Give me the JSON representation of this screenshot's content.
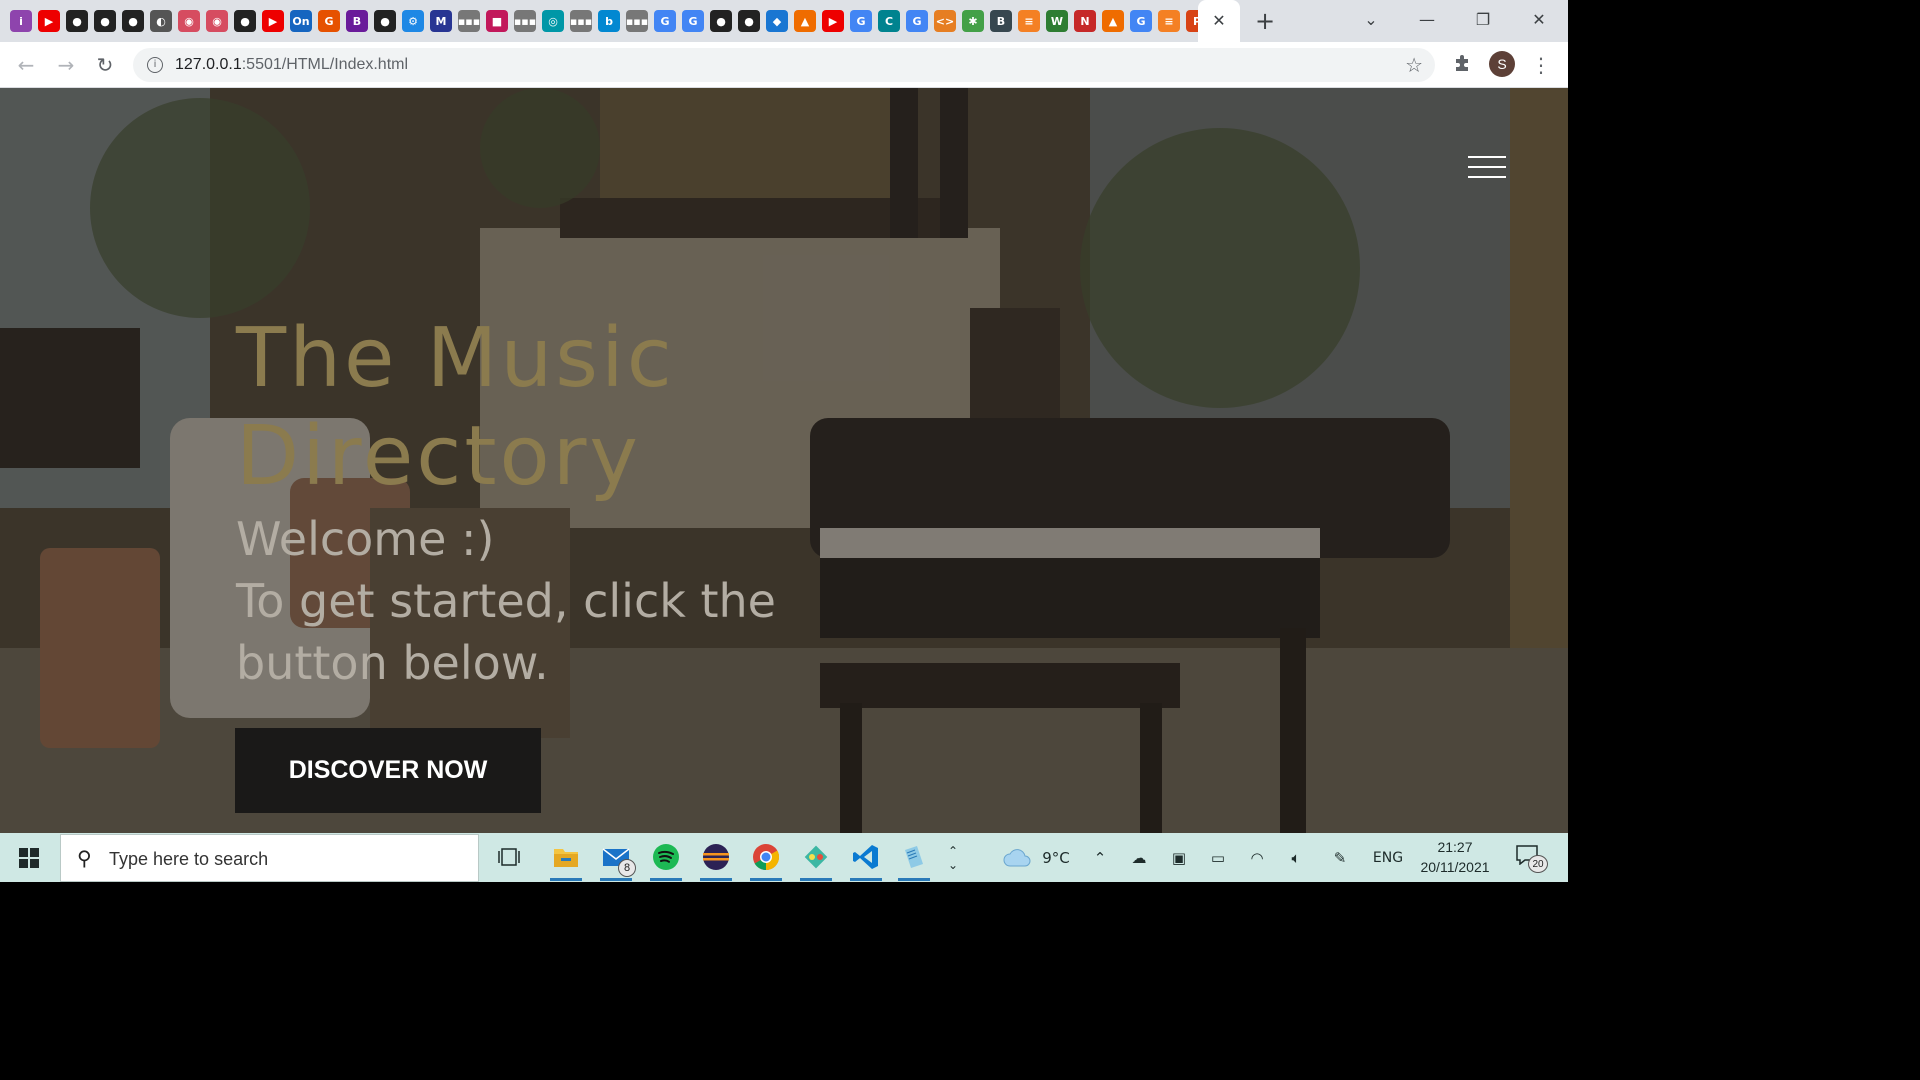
{
  "browser": {
    "active_tab": {
      "close_label": "✕"
    },
    "new_tab_label": "+",
    "tab_favicons": [
      {
        "name": "tab-favicon-1",
        "glyph": "i",
        "color": "#8e44ad"
      },
      {
        "name": "tab-favicon-youtube",
        "glyph": "▶",
        "color": "#e00"
      },
      {
        "name": "tab-favicon-github",
        "glyph": "●",
        "color": "#222"
      },
      {
        "name": "tab-favicon-github",
        "glyph": "●",
        "color": "#222"
      },
      {
        "name": "tab-favicon-github",
        "glyph": "●",
        "color": "#222"
      },
      {
        "name": "tab-favicon-globe",
        "glyph": "◐",
        "color": "#555"
      },
      {
        "name": "tab-favicon-pink",
        "glyph": "◉",
        "color": "#d64c60"
      },
      {
        "name": "tab-favicon-pink",
        "glyph": "◉",
        "color": "#d64c60"
      },
      {
        "name": "tab-favicon-github",
        "glyph": "●",
        "color": "#222"
      },
      {
        "name": "tab-favicon-youtube",
        "glyph": "▶",
        "color": "#e00"
      },
      {
        "name": "tab-favicon-on",
        "glyph": "On",
        "color": "#1565c0"
      },
      {
        "name": "tab-favicon-g",
        "glyph": "G",
        "color": "#e65100"
      },
      {
        "name": "tab-favicon-b",
        "glyph": "B",
        "color": "#6a1b9a"
      },
      {
        "name": "tab-favicon-github",
        "glyph": "●",
        "color": "#222"
      },
      {
        "name": "tab-favicon-gear",
        "glyph": "⚙",
        "color": "#1e88e5"
      },
      {
        "name": "tab-favicon-mvn",
        "glyph": "M",
        "color": "#283593"
      },
      {
        "name": "tab-favicon-dots",
        "glyph": "▪▪▪",
        "color": "#777"
      },
      {
        "name": "tab-favicon-square",
        "glyph": "■",
        "color": "#c2185b"
      },
      {
        "name": "tab-favicon-dots",
        "glyph": "▪▪▪",
        "color": "#777"
      },
      {
        "name": "tab-favicon-edge",
        "glyph": "◎",
        "color": "#0097a7"
      },
      {
        "name": "tab-favicon-dots",
        "glyph": "▪▪▪",
        "color": "#777"
      },
      {
        "name": "tab-favicon-bing",
        "glyph": "b",
        "color": "#0288d1"
      },
      {
        "name": "tab-favicon-dots",
        "glyph": "▪▪▪",
        "color": "#777"
      },
      {
        "name": "tab-favicon-google",
        "glyph": "G",
        "color": "#4285f4"
      },
      {
        "name": "tab-favicon-google",
        "glyph": "G",
        "color": "#4285f4"
      },
      {
        "name": "tab-favicon-github",
        "glyph": "●",
        "color": "#222"
      },
      {
        "name": "tab-favicon-github",
        "glyph": "●",
        "color": "#222"
      },
      {
        "name": "tab-favicon-diamond",
        "glyph": "◆",
        "color": "#1976d2"
      },
      {
        "name": "tab-favicon-orange",
        "glyph": "▲",
        "color": "#ef6c00"
      },
      {
        "name": "tab-favicon-youtube",
        "glyph": "▶",
        "color": "#e00"
      },
      {
        "name": "tab-favicon-google",
        "glyph": "G",
        "color": "#4285f4"
      },
      {
        "name": "tab-favicon-c",
        "glyph": "C",
        "color": "#00838f"
      },
      {
        "name": "tab-favicon-google",
        "glyph": "G",
        "color": "#4285f4"
      },
      {
        "name": "tab-favicon-code",
        "glyph": "<>",
        "color": "#e67e22"
      },
      {
        "name": "tab-favicon-colors",
        "glyph": "✱",
        "color": "#43a047"
      },
      {
        "name": "tab-favicon-b",
        "glyph": "B",
        "color": "#37474f"
      },
      {
        "name": "tab-favicon-stack",
        "glyph": "≡",
        "color": "#f48024"
      },
      {
        "name": "tab-favicon-w",
        "glyph": "W",
        "color": "#2e7d32"
      },
      {
        "name": "tab-favicon-n",
        "glyph": "N",
        "color": "#c62828"
      },
      {
        "name": "tab-favicon-orange",
        "glyph": "▲",
        "color": "#ef6c00"
      },
      {
        "name": "tab-favicon-google",
        "glyph": "G",
        "color": "#4285f4"
      },
      {
        "name": "tab-favicon-stack",
        "glyph": "≡",
        "color": "#f48024"
      },
      {
        "name": "tab-favicon-p",
        "glyph": "P",
        "color": "#d84315"
      }
    ],
    "window_controls": {
      "tab_search": "⌄",
      "minimize": "—",
      "restore": "❐",
      "close": "✕"
    },
    "address": {
      "host": "127.0.0.1",
      "rest": ":5501/HTML/Index.html"
    },
    "profile_initial": "S",
    "colors": {
      "tabstrip": "#dee1e6",
      "toolbar": "#ffffff",
      "omnibox": "#f1f3f4"
    }
  },
  "page": {
    "hero_title": "The Music Directory",
    "hero_welcome": "Welcome :)",
    "hero_instruction": "To get started, click the button below.",
    "cta_label": "DISCOVER NOW",
    "colors": {
      "title": "#8b7b4e",
      "subtitle": "#b3ada3",
      "button_bg": "#1a1918",
      "button_text": "#ffffff"
    }
  },
  "taskbar": {
    "search_placeholder": "Type here to search",
    "apps": [
      {
        "name": "task-view-icon",
        "active": false
      },
      {
        "name": "file-explorer-icon",
        "active": true
      },
      {
        "name": "mail-icon",
        "active": true,
        "badge": "8"
      },
      {
        "name": "spotify-icon",
        "active": true
      },
      {
        "name": "eclipse-icon",
        "active": true
      },
      {
        "name": "chrome-icon",
        "active": true
      },
      {
        "name": "git-client-icon",
        "active": true
      },
      {
        "name": "vscode-icon",
        "active": true
      },
      {
        "name": "notepad-icon",
        "active": true
      }
    ],
    "weather": "9°C",
    "language": "ENG",
    "time": "21:27",
    "date": "20/11/2021",
    "notification_count": "20",
    "colors": {
      "background": "#cfe8e4"
    }
  }
}
